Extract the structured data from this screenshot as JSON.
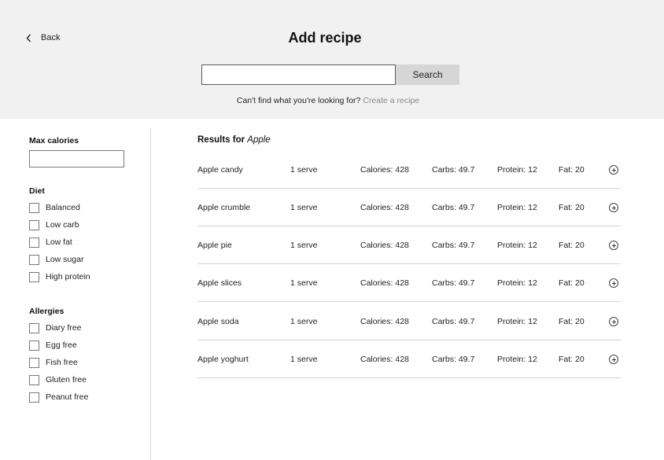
{
  "header": {
    "back_label": "Back",
    "title": "Add recipe",
    "search_value": "",
    "search_button": "Search",
    "hint_text": "Can't find what you're looking for?",
    "hint_link": "Create a recipe"
  },
  "filters": {
    "max_calories_label": "Max calories",
    "max_calories_value": "",
    "diet_label": "Diet",
    "diet_options": [
      "Balanced",
      "Low carb",
      "Low fat",
      "Low sugar",
      "High protein"
    ],
    "allergies_label": "Allergies",
    "allergy_options": [
      "Diary free",
      "Egg free",
      "Fish free",
      "Gluten free",
      "Peanut free"
    ]
  },
  "results": {
    "prefix": "Results for",
    "query": "Apple",
    "rows": [
      {
        "name": "Apple candy",
        "serve": "1 serve",
        "calories": "Calories: 428",
        "carbs": "Carbs: 49.7",
        "protein": "Protein: 12",
        "fat": "Fat: 20"
      },
      {
        "name": "Apple crumble",
        "serve": "1 serve",
        "calories": "Calories: 428",
        "carbs": "Carbs: 49.7",
        "protein": "Protein: 12",
        "fat": "Fat: 20"
      },
      {
        "name": "Apple pie",
        "serve": "1 serve",
        "calories": "Calories: 428",
        "carbs": "Carbs: 49.7",
        "protein": "Protein: 12",
        "fat": "Fat: 20"
      },
      {
        "name": "Apple slices",
        "serve": "1 serve",
        "calories": "Calories: 428",
        "carbs": "Carbs: 49.7",
        "protein": "Protein: 12",
        "fat": "Fat: 20"
      },
      {
        "name": "Apple soda",
        "serve": "1 serve",
        "calories": "Calories: 428",
        "carbs": "Carbs: 49.7",
        "protein": "Protein: 12",
        "fat": "Fat: 20"
      },
      {
        "name": "Apple yoghurt",
        "serve": "1 serve",
        "calories": "Calories: 428",
        "carbs": "Carbs: 49.7",
        "protein": "Protein: 12",
        "fat": "Fat: 20"
      }
    ]
  },
  "icons": {
    "back": "chevron-left-icon",
    "add": "plus-circle-icon"
  }
}
